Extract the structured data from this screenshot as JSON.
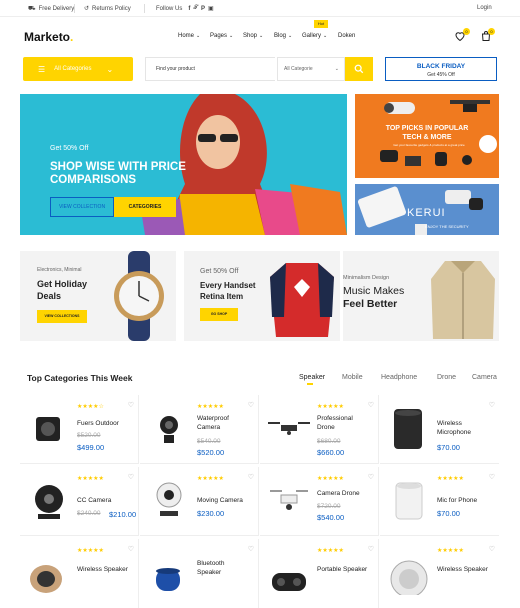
{
  "topbar": {
    "free_delivery": "Free Delivery",
    "returns": "Returns Policy",
    "follow": "Follow Us",
    "login": "Login"
  },
  "header": {
    "logo": "Marketo",
    "nav": [
      "Home",
      "Pages",
      "Shop",
      "Blog",
      "Gallery",
      "Doken"
    ],
    "hot_badge": "Hot",
    "wishlist_count": "0",
    "cart_count": "0"
  },
  "search": {
    "all_categories": "All Categories",
    "placeholder": "Find your product",
    "category_select": "All Categorie",
    "black_friday": "BLACK FRIDAY",
    "black_friday_sub": "Get 45% Off"
  },
  "hero": {
    "kicker": "Get 50% Off",
    "title_line1": "SHOP WISE WITH PRICE",
    "title_line2": "COMPARISONS",
    "btn_view": "VIEW COLLECTION",
    "btn_categories": "CATEGORIES"
  },
  "side": {
    "top_title1": "TOP PICKS IN POPULAR",
    "top_title2": "TECH & MORE",
    "top_sub": "Get your favourite gadgets & products at a great price",
    "bottom_brand": "KERUI",
    "bottom_sub": "ENJOY THE SECURITY"
  },
  "cards": [
    {
      "kicker": "Electronics, Minimal",
      "title1": "Get Holiday",
      "title2": "Deals",
      "btn": "VIEW COLLECTIONS"
    },
    {
      "kicker": "Get 50% Off",
      "title1": "Every Handset",
      "title2": "Retina Item",
      "btn": "GO SHOP"
    },
    {
      "kicker": "Minimalism Design",
      "title1": "Music Makes",
      "title2": "Feel Better"
    }
  ],
  "top_categories": {
    "title": "Top Categories This Week",
    "tabs": [
      "Speaker",
      "Mobile",
      "Headphone",
      "Drone",
      "Camera"
    ]
  },
  "products": [
    {
      "name1": "Fuers Outdoor",
      "name2": "",
      "old": "$520.00",
      "price": "$499.00",
      "stars": "★★★★☆"
    },
    {
      "name1": "Waterproof",
      "name2": "Camera",
      "old": "$540.00",
      "price": "$520.00",
      "stars": "★★★★★"
    },
    {
      "name1": "Professional",
      "name2": "Drone",
      "old": "$680.00",
      "price": "$660.00",
      "stars": "★★★★★"
    },
    {
      "name1": "Wireless",
      "name2": "Microphone",
      "old": "",
      "price": "$70.00",
      "stars": ""
    },
    {
      "name1": "CC Camera",
      "name2": "",
      "old": "$240.00",
      "price": "$210.00",
      "stars": "★★★★★"
    },
    {
      "name1": "Moving Camera",
      "name2": "",
      "old": "",
      "price": "$230.00",
      "stars": "★★★★★"
    },
    {
      "name1": "Camera Drone",
      "name2": "",
      "old": "$720.00",
      "price": "$540.00",
      "stars": "★★★★★"
    },
    {
      "name1": "Mic for Phone",
      "name2": "",
      "old": "",
      "price": "$70.00",
      "stars": "★★★★★"
    },
    {
      "name1": "Wireless Speaker",
      "name2": "",
      "old": "",
      "price": "",
      "stars": "★★★★★"
    },
    {
      "name1": "Bluetooth",
      "name2": "Speaker",
      "old": "",
      "price": "",
      "stars": ""
    },
    {
      "name1": "Portable Speaker",
      "name2": "",
      "old": "",
      "price": "",
      "stars": "★★★★★"
    },
    {
      "name1": "Wireless Speaker",
      "name2": "",
      "old": "",
      "price": "",
      "stars": "★★★★★"
    }
  ],
  "colors": {
    "accent": "#ffd400",
    "brand_blue": "#0a5dc2",
    "hero_bg": "#2bbcd4",
    "side_orange": "#f07a1f"
  }
}
